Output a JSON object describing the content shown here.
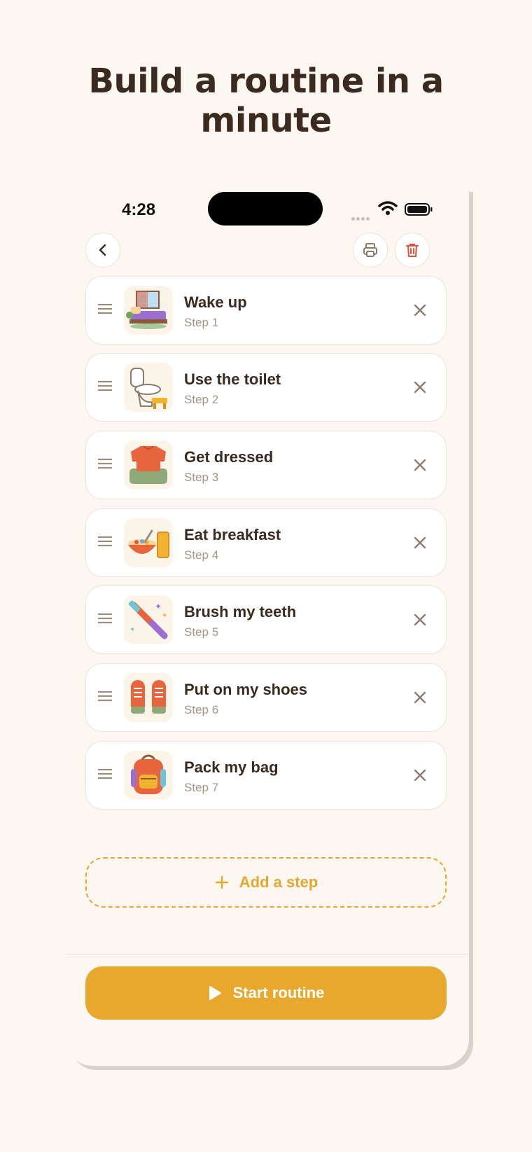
{
  "headline": {
    "line1": "Build a routine in a",
    "line2": "minute"
  },
  "status_bar": {
    "time": "4:28"
  },
  "toolbar": {
    "back_icon": "chevron-left-icon",
    "print_icon": "printer-icon",
    "delete_icon": "trash-icon"
  },
  "steps": [
    {
      "title": "Wake up",
      "subtitle": "Step 1",
      "icon": "bed-icon"
    },
    {
      "title": "Use the toilet",
      "subtitle": "Step 2",
      "icon": "toilet-icon"
    },
    {
      "title": "Get dressed",
      "subtitle": "Step 3",
      "icon": "clothes-icon"
    },
    {
      "title": "Eat breakfast",
      "subtitle": "Step 4",
      "icon": "cereal-bowl-icon"
    },
    {
      "title": "Brush my teeth",
      "subtitle": "Step 5",
      "icon": "toothbrush-icon"
    },
    {
      "title": "Put on my shoes",
      "subtitle": "Step 6",
      "icon": "shoes-icon"
    },
    {
      "title": "Pack my bag",
      "subtitle": "Step 7",
      "icon": "backpack-icon"
    }
  ],
  "add_step": {
    "label": "Add a step"
  },
  "start": {
    "label": "Start routine"
  },
  "colors": {
    "accent": "#e8a82e",
    "background": "#fcf7f0",
    "text": "#3a2a1f",
    "muted": "#a39587",
    "danger": "#d9533a"
  }
}
